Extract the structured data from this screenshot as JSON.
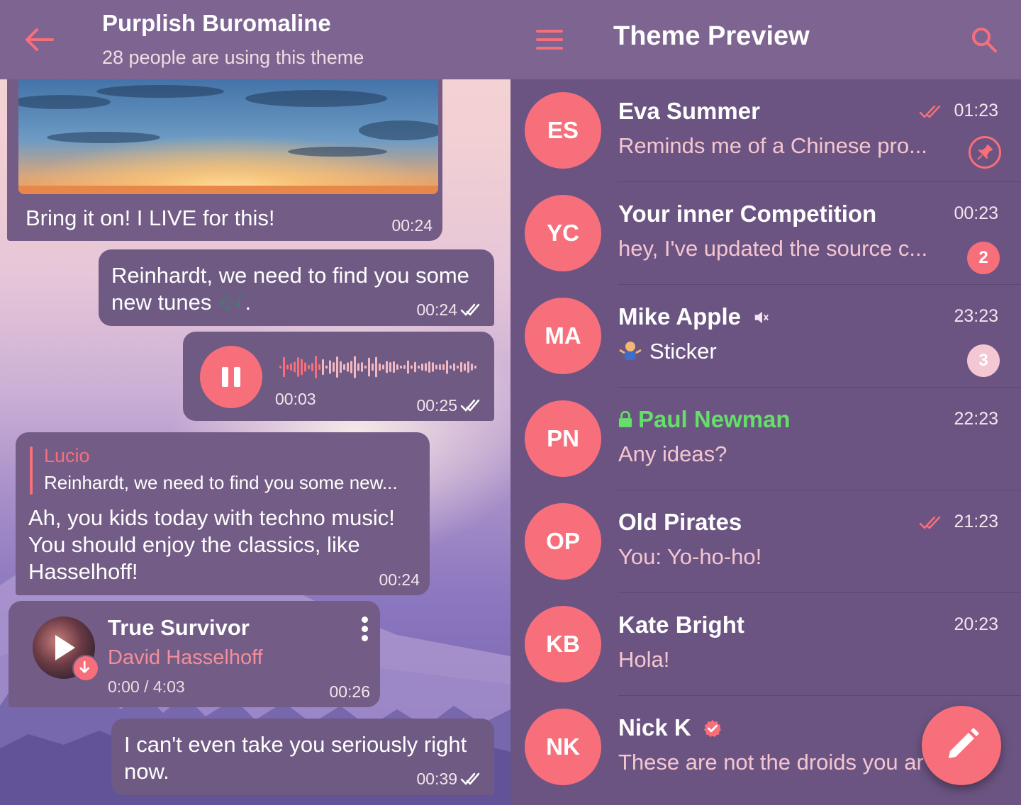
{
  "chat_header": {
    "title": "Purplish Buromaline",
    "subtitle": "28 people are using this theme"
  },
  "messages": [
    {
      "type": "photo",
      "text": "Bring it on! I LIVE for this!",
      "time": "00:24"
    },
    {
      "type": "text_out",
      "text": "Reinhardt, we need to find you some new tunes 🎶.",
      "time": "00:24"
    },
    {
      "type": "voice",
      "duration": "00:03",
      "time": "00:25"
    },
    {
      "type": "reply_in",
      "reply_author": "Lucio",
      "reply_text": "Reinhardt, we need to find you some new...",
      "text": "Ah, you kids today with techno music! You should enjoy the classics, like Hasselhoff!",
      "time": "00:24"
    },
    {
      "type": "audio",
      "title": "True Survivor",
      "artist": "David Hasselhoff",
      "position": "0:00 / 4:03",
      "time": "00:26"
    },
    {
      "type": "text_out",
      "text": "I can't even take you seriously right now.",
      "time": "00:39"
    }
  ],
  "list_header": {
    "title": "Theme Preview"
  },
  "chats": [
    {
      "initials": "ES",
      "name": "Eva Summer",
      "message": "Reminds me of a Chinese pro...",
      "time": "01:23"
    },
    {
      "initials": "YC",
      "name": "Your inner Competition",
      "message": "hey, I've updated the source c...",
      "time": "00:23",
      "badge": "2"
    },
    {
      "initials": "MA",
      "name": "Mike Apple",
      "message": "Sticker",
      "time": "23:23",
      "badge": "3"
    },
    {
      "initials": "PN",
      "name": "Paul Newman",
      "message": "Any ideas?",
      "time": "22:23"
    },
    {
      "initials": "OP",
      "name": "Old Pirates",
      "message": "You: Yo-ho-ho!",
      "time": "21:23"
    },
    {
      "initials": "KB",
      "name": "Kate Bright",
      "message": "Hola!",
      "time": "20:23"
    },
    {
      "initials": "NK",
      "name": "Nick K",
      "message": "These are not the droids you ar",
      "time": ""
    }
  ],
  "icons": {
    "back": "back-arrow-icon",
    "menu": "hamburger-menu-icon",
    "search": "search-icon",
    "compose": "pencil-icon"
  },
  "colors": {
    "accent": "#f76f7b",
    "header": "#7e6491",
    "list_background": "#6b5482",
    "bubble": "#735c85",
    "secret_chat_name": "#65de6a"
  }
}
